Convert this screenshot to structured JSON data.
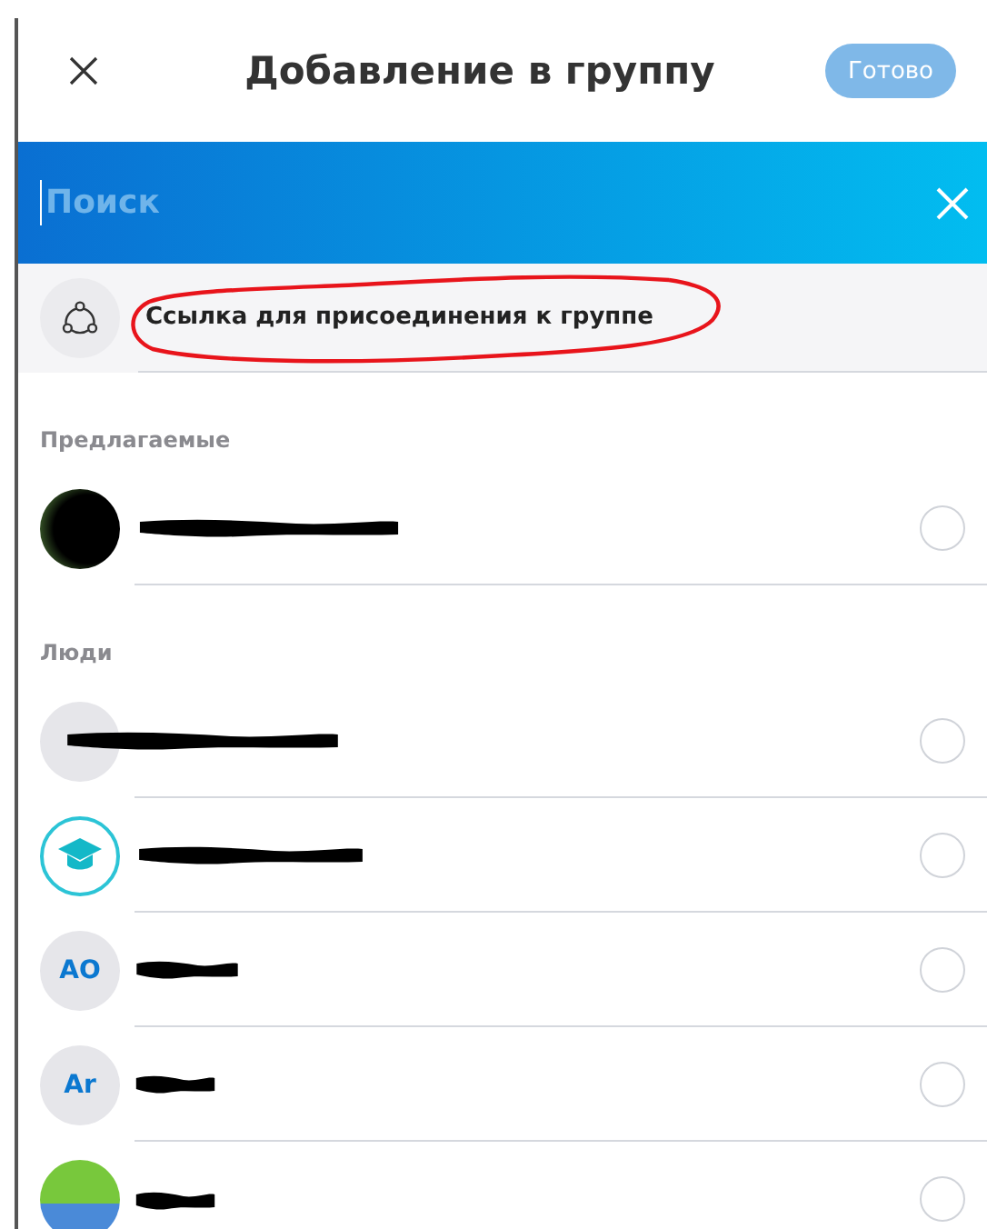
{
  "header": {
    "title": "Добавление в группу",
    "done_button": {
      "label": "Готово",
      "disabled": true
    }
  },
  "search": {
    "placeholder": "Поиск"
  },
  "join_link": {
    "label": "Ссылка для присоединения к группе",
    "annotated": true
  },
  "sections": [
    {
      "title": "Предлагаемые",
      "contacts": [
        {
          "kind": "photo",
          "selected": false
        }
      ]
    },
    {
      "title": "Люди",
      "contacts": [
        {
          "kind": "blank",
          "selected": false
        },
        {
          "kind": "cap",
          "selected": false
        },
        {
          "kind": "initials",
          "initials": "AO",
          "selected": false
        },
        {
          "kind": "initials",
          "initials": "Ar",
          "selected": false
        },
        {
          "kind": "leaf",
          "selected": false
        }
      ]
    }
  ]
}
